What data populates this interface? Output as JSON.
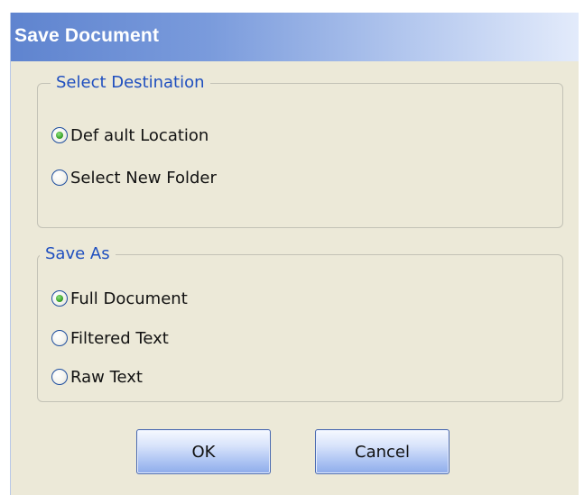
{
  "dialog": {
    "title": "Save Document"
  },
  "destination_group": {
    "legend": "Select Destination",
    "options": [
      {
        "label": "Def ault Location",
        "checked": true
      },
      {
        "label": "Select New Folder",
        "checked": false
      }
    ]
  },
  "save_as_group": {
    "legend": "Save As",
    "options": [
      {
        "label": "Full Document",
        "checked": true
      },
      {
        "label": "Filtered Text",
        "checked": false
      },
      {
        "label": "Raw Text",
        "checked": false
      }
    ]
  },
  "buttons": {
    "ok_label": "OK",
    "cancel_label": "Cancel"
  },
  "colors": {
    "title_bar_start": "#5f84cf",
    "title_bar_end": "#e3ebfb",
    "dialog_background": "#ece9d8",
    "group_legend_text": "#1f4fbf",
    "radio_checked_dot": "#2f9a1f"
  }
}
